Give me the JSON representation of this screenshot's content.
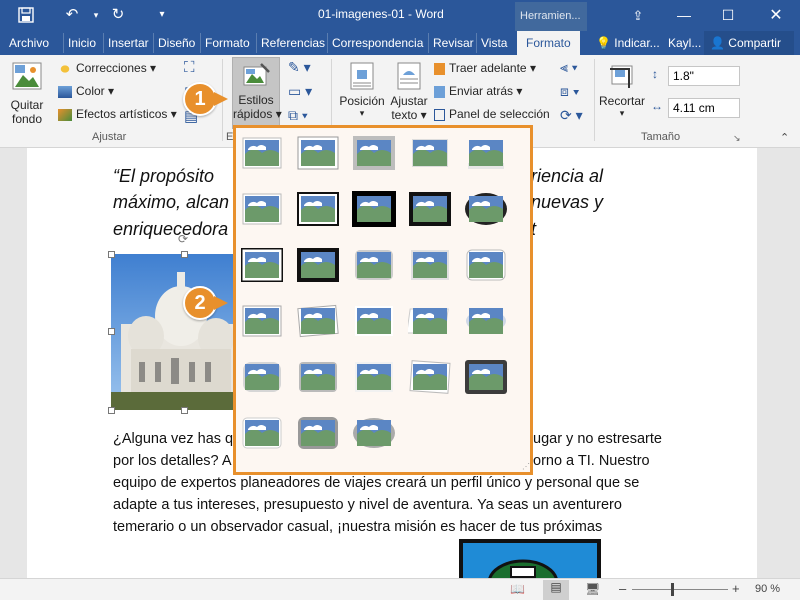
{
  "titlebar": {
    "doc_title": "01-imagenes-01  -  Word",
    "contextual_tab": "Herramien..."
  },
  "tabs": [
    {
      "label": "Archivo"
    },
    {
      "label": "Inicio"
    },
    {
      "label": "Insertar"
    },
    {
      "label": "Diseño"
    },
    {
      "label": "Formato"
    },
    {
      "label": "Referencias"
    },
    {
      "label": "Correspondencia"
    },
    {
      "label": "Revisar"
    },
    {
      "label": "Vista"
    },
    {
      "label": "Formato"
    }
  ],
  "tell_me": "Indicar...",
  "user": "Kayl...",
  "share_label": "Compartir",
  "ribbon": {
    "quitar_fondo": [
      "Quitar",
      "fondo"
    ],
    "correcciones": "Correcciones",
    "color": "Color",
    "efectos": "Efectos artísticos",
    "group_ajustar": "Ajustar",
    "group_estilos_partial": "Es",
    "estilos_rapidos": [
      "Estilos",
      "rápidos"
    ],
    "posicion": "Posición",
    "ajustar_texto": [
      "Ajustar",
      "texto"
    ],
    "traer_adelante": "Traer adelante",
    "enviar_atras": "Enviar atrás",
    "panel_seleccion": "Panel de selección",
    "recortar": "Recortar",
    "height_value": "1.8\"",
    "width_value": "4.11 cm",
    "group_tamano": "Tamaño"
  },
  "document": {
    "quote_lines": [
      "“El propósito",
      "máximo, alcan",
      "enriquecedora"
    ],
    "quote_right": [
      "riencia al",
      "nuevas y",
      "t"
    ],
    "para_lines": [
      "¿Alguna vez has q",
      "por los detalles?  A",
      "equipo de expertos planeadores de viajes creará un perfil único y personal que se",
      "adapte a tus intereses, presupuesto y nivel de aventura. Ya seas un aventurero",
      "temerario o un observador casual, ¡nuestra misión es hacer de tus próximas"
    ],
    "para_right": [
      "ugar y no estresarte",
      "orno a TI. Nuestro"
    ]
  },
  "callouts": [
    "1",
    "2"
  ],
  "status": {
    "zoom": "90 %"
  },
  "colors": {
    "word_blue": "#2b579a",
    "callout_orange": "#e8902c"
  }
}
